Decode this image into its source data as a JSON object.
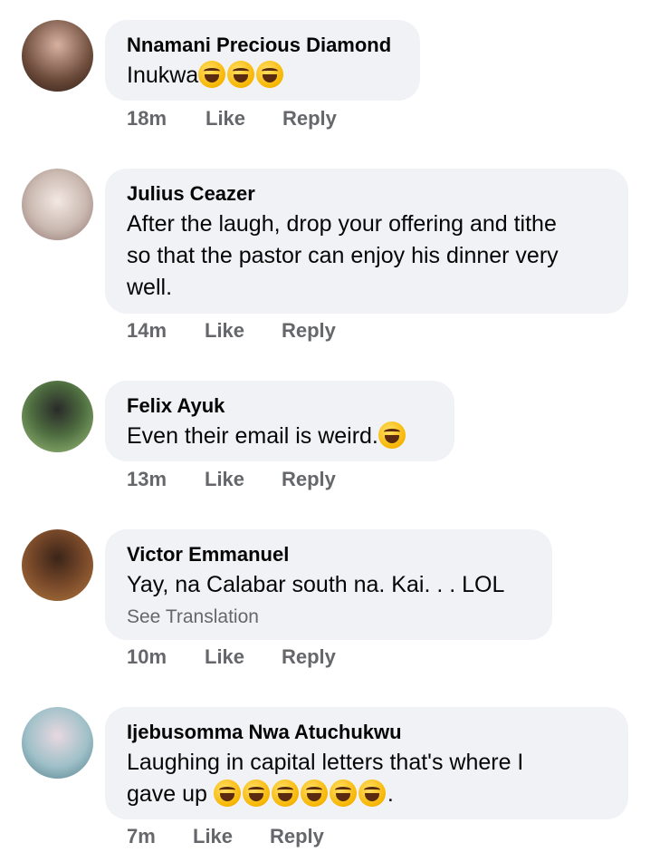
{
  "comments": [
    {
      "name": "Nnamani Precious Diamond",
      "text": "Inukwa",
      "emoji_count": 3,
      "emoji_icon": "rolling-laughing-emoji-icon",
      "time": "18m",
      "like": "Like",
      "reply": "Reply",
      "avatar_color": "#6b4a3a"
    },
    {
      "name": "Julius Ceazer",
      "text_lines": [
        "After the laugh, drop your offering and tithe",
        "so that the pastor can enjoy his dinner very",
        "well."
      ],
      "time": "14m",
      "like": "Like",
      "reply": "Reply",
      "avatar_color": "#c9b8b0"
    },
    {
      "name": "Felix Ayuk",
      "text": "Even their email is weird.",
      "emoji_count": 1,
      "emoji_icon": "tears-of-joy-emoji-icon",
      "time": "13m",
      "like": "Like",
      "reply": "Reply",
      "avatar_color": "#6f8f5a"
    },
    {
      "name": "Victor Emmanuel",
      "text": "Yay, na Calabar south na. Kai. . . LOL",
      "see_translation": "See Translation",
      "time": "10m",
      "like": "Like",
      "reply": "Reply",
      "avatar_color": "#7a4a2a"
    },
    {
      "name": "Ijebusomma Nwa Atuchukwu",
      "text_line1": "Laughing in capital letters that's where I",
      "text_line2": "gave up",
      "text_end": ".",
      "emoji_count": 6,
      "emoji_icon": "tears-of-joy-emoji-icon",
      "time": "7m",
      "like": "Like",
      "reply": "Reply",
      "avatar_color": "#9fc0c8"
    }
  ]
}
